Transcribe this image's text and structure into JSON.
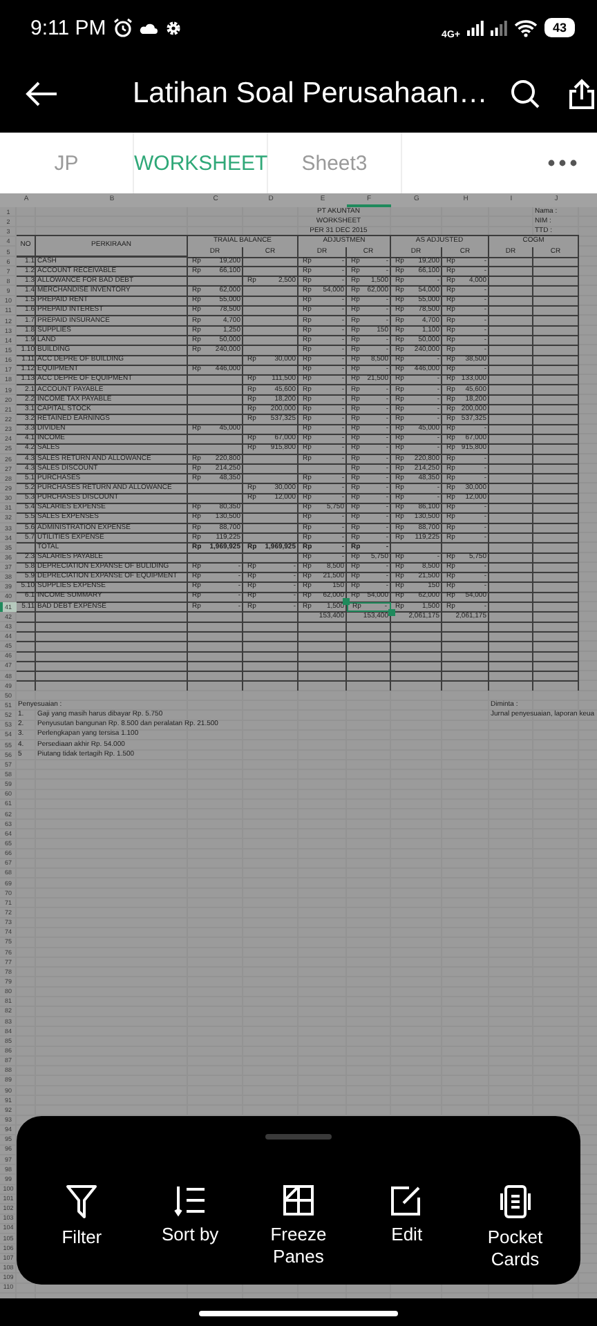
{
  "status_bar": {
    "time": "9:11 PM",
    "network": "4G+",
    "battery": "43"
  },
  "app_bar": {
    "title": "Latihan Soal Perusahaan…"
  },
  "sheet_tabs": [
    {
      "label": "JP",
      "selected": false
    },
    {
      "label": "WORKSHEET",
      "selected": true
    },
    {
      "label": "Sheet3",
      "selected": false
    }
  ],
  "spreadsheet": {
    "columns": [
      {
        "label": "A",
        "selected": false
      },
      {
        "label": "B",
        "selected": false
      },
      {
        "label": "C",
        "selected": false
      },
      {
        "label": "D",
        "selected": false
      },
      {
        "label": "E",
        "selected": false
      },
      {
        "label": "F",
        "selected": true
      },
      {
        "label": "G",
        "selected": false
      },
      {
        "label": "H",
        "selected": false
      },
      {
        "label": "I",
        "selected": false
      },
      {
        "label": "J",
        "selected": false
      }
    ],
    "rows": [
      {
        "kind": "title",
        "n": "1",
        "selected": false,
        "title": "PT AKUNTAN",
        "side": "Nama :"
      },
      {
        "kind": "title",
        "n": "2",
        "selected": false,
        "title": "WORKSHEET",
        "side": "NIM   :"
      },
      {
        "kind": "title",
        "n": "3",
        "selected": false,
        "title": "PER 31 DEC 2015",
        "side": "TTD   :"
      },
      {
        "kind": "header",
        "n": [
          "4",
          "5"
        ],
        "selected": false,
        "no": "NO",
        "account": "PERKIRAAN",
        "groups": [
          {
            "label": "TRAIAL BALANCE",
            "sub": [
              "DR",
              "CR"
            ]
          },
          {
            "label": "ADJUSTMEN",
            "sub": [
              "DR",
              "CR"
            ]
          },
          {
            "label": "AS ADJUSTED",
            "sub": [
              "DR",
              "CR"
            ]
          },
          {
            "label": "COGM",
            "sub": [
              "DR",
              "CR"
            ]
          }
        ]
      },
      {
        "kind": "account",
        "n": "6",
        "selected": false,
        "no": "1.1",
        "account": "CASH",
        "amounts": {
          "tb_dr": [
            "Rp",
            "19,200"
          ],
          "adj_dr": [
            "Rp",
            "-"
          ],
          "adj_cr": [
            "Rp",
            "-"
          ],
          "aa_dr": [
            "Rp",
            "19,200"
          ],
          "aa_cr": [
            "Rp",
            "-"
          ]
        }
      },
      {
        "kind": "account",
        "n": "7",
        "selected": false,
        "no": "1.2",
        "account": "ACCOUNT RECEIVABLE",
        "amounts": {
          "tb_dr": [
            "Rp",
            "66,100"
          ],
          "adj_dr": [
            "Rp",
            "-"
          ],
          "adj_cr": [
            "Rp",
            "-"
          ],
          "aa_dr": [
            "Rp",
            "66,100"
          ],
          "aa_cr": [
            "Rp",
            "-"
          ]
        }
      },
      {
        "kind": "account",
        "n": "8",
        "selected": false,
        "no": "1.3",
        "account": "ALLOWANCE FOR BAD DEBT",
        "amounts": {
          "tb_cr": [
            "Rp",
            "2,500"
          ],
          "adj_dr": [
            "Rp",
            "-"
          ],
          "adj_cr": [
            "Rp",
            "1,500"
          ],
          "aa_dr": [
            "Rp",
            "-"
          ],
          "aa_cr": [
            "Rp",
            "4,000"
          ]
        }
      },
      {
        "kind": "account",
        "n": "9",
        "selected": false,
        "no": "1.4",
        "account": "MERCHANDISE INVENTORY",
        "amounts": {
          "tb_dr": [
            "Rp",
            "62,000"
          ],
          "adj_dr": [
            "Rp",
            "54,000"
          ],
          "adj_cr": [
            "Rp",
            "62,000"
          ],
          "aa_dr": [
            "Rp",
            "54,000"
          ],
          "aa_cr": [
            "Rp",
            "-"
          ]
        }
      },
      {
        "kind": "account",
        "n": "10",
        "selected": false,
        "no": "1.5",
        "account": "PREPAID RENT",
        "amounts": {
          "tb_dr": [
            "Rp",
            "55,000"
          ],
          "adj_dr": [
            "Rp",
            "-"
          ],
          "adj_cr": [
            "Rp",
            "-"
          ],
          "aa_dr": [
            "Rp",
            "55,000"
          ],
          "aa_cr": [
            "Rp",
            "-"
          ]
        }
      },
      {
        "kind": "account",
        "n": "11",
        "selected": false,
        "no": "1.6",
        "account": "PREPAID INTEREST",
        "amounts": {
          "tb_dr": [
            "Rp",
            "78,500"
          ],
          "adj_dr": [
            "Rp",
            "-"
          ],
          "adj_cr": [
            "Rp",
            "-"
          ],
          "aa_dr": [
            "Rp",
            "78,500"
          ],
          "aa_cr": [
            "Rp",
            "-"
          ]
        }
      },
      {
        "kind": "account",
        "n": "12",
        "selected": false,
        "no": "1.7",
        "account": "PREPAID INSURANCE",
        "amounts": {
          "tb_dr": [
            "Rp",
            "4,700"
          ],
          "adj_dr": [
            "Rp",
            "-"
          ],
          "adj_cr": [
            "Rp",
            "-"
          ],
          "aa_dr": [
            "Rp",
            "4,700"
          ],
          "aa_cr": [
            "Rp",
            "-"
          ]
        }
      },
      {
        "kind": "account",
        "n": "13",
        "selected": false,
        "no": "1.8",
        "account": "SUPPLIES",
        "amounts": {
          "tb_dr": [
            "Rp",
            "1,250"
          ],
          "adj_dr": [
            "Rp",
            "-"
          ],
          "adj_cr": [
            "Rp",
            "150"
          ],
          "aa_dr": [
            "Rp",
            "1,100"
          ],
          "aa_cr": [
            "Rp",
            "-"
          ]
        }
      },
      {
        "kind": "account",
        "n": "14",
        "selected": false,
        "no": "1.9",
        "account": "LAND",
        "amounts": {
          "tb_dr": [
            "Rp",
            "50,000"
          ],
          "adj_dr": [
            "Rp",
            "-"
          ],
          "adj_cr": [
            "Rp",
            "-"
          ],
          "aa_dr": [
            "Rp",
            "50,000"
          ],
          "aa_cr": [
            "Rp",
            "-"
          ]
        }
      },
      {
        "kind": "account",
        "n": "15",
        "selected": false,
        "no": "1.10",
        "account": "BUILDING",
        "amounts": {
          "tb_dr": [
            "Rp",
            "240,000"
          ],
          "adj_dr": [
            "Rp",
            "-"
          ],
          "adj_cr": [
            "Rp",
            "-"
          ],
          "aa_dr": [
            "Rp",
            "240,000"
          ],
          "aa_cr": [
            "Rp",
            "-"
          ]
        }
      },
      {
        "kind": "account",
        "n": "16",
        "selected": false,
        "no": "1.11",
        "account": "ACC DEPRE OF  BUILDING",
        "amounts": {
          "tb_cr": [
            "Rp",
            "30,000"
          ],
          "adj_dr": [
            "Rp",
            "-"
          ],
          "adj_cr": [
            "Rp",
            "8,500"
          ],
          "aa_dr": [
            "Rp",
            "-"
          ],
          "aa_cr": [
            "Rp",
            "38,500"
          ]
        }
      },
      {
        "kind": "account",
        "n": "17",
        "selected": false,
        "no": "1.12",
        "account": "EQUIPMENT",
        "amounts": {
          "tb_dr": [
            "Rp",
            "446,000"
          ],
          "adj_dr": [
            "Rp",
            "-"
          ],
          "adj_cr": [
            "Rp",
            "-"
          ],
          "aa_dr": [
            "Rp",
            "446,000"
          ],
          "aa_cr": [
            "Rp",
            "-"
          ]
        }
      },
      {
        "kind": "account",
        "n": "18",
        "selected": false,
        "no": "1.13",
        "account": "ACC DEPRE OF  EQUIPMENT",
        "amounts": {
          "tb_cr": [
            "Rp",
            "111,500"
          ],
          "adj_dr": [
            "Rp",
            "-"
          ],
          "adj_cr": [
            "Rp",
            "21,500"
          ],
          "aa_dr": [
            "Rp",
            "-"
          ],
          "aa_cr": [
            "Rp",
            "133,000"
          ]
        }
      },
      {
        "kind": "account",
        "n": "19",
        "selected": false,
        "no": "2.1",
        "account": "ACCOUNT PAYABLE",
        "amounts": {
          "tb_cr": [
            "Rp",
            "45,600"
          ],
          "adj_dr": [
            "Rp",
            "-"
          ],
          "adj_cr": [
            "Rp",
            "-"
          ],
          "aa_dr": [
            "Rp",
            "-"
          ],
          "aa_cr": [
            "Rp",
            "45,600"
          ]
        }
      },
      {
        "kind": "account",
        "n": "20",
        "selected": false,
        "no": "2.2",
        "account": "INCOME TAX PAYABLE",
        "amounts": {
          "tb_cr": [
            "Rp",
            "18,200"
          ],
          "adj_dr": [
            "Rp",
            "-"
          ],
          "adj_cr": [
            "Rp",
            "-"
          ],
          "aa_dr": [
            "Rp",
            "-"
          ],
          "aa_cr": [
            "Rp",
            "18,200"
          ]
        }
      },
      {
        "kind": "account",
        "n": "21",
        "selected": false,
        "no": "3.1",
        "account": "CAPITAL STOCK",
        "amounts": {
          "tb_cr": [
            "Rp",
            "200,000"
          ],
          "adj_dr": [
            "Rp",
            "-"
          ],
          "adj_cr": [
            "Rp",
            "-"
          ],
          "aa_dr": [
            "Rp",
            "-"
          ],
          "aa_cr": [
            "Rp",
            "200,000"
          ]
        }
      },
      {
        "kind": "account",
        "n": "22",
        "selected": false,
        "no": "3.2",
        "account": "RETAINED EARNINGS",
        "amounts": {
          "tb_cr": [
            "Rp",
            "537,325"
          ],
          "adj_dr": [
            "Rp",
            "-"
          ],
          "adj_cr": [
            "Rp",
            "-"
          ],
          "aa_dr": [
            "Rp",
            "-"
          ],
          "aa_cr": [
            "Rp",
            "537,325"
          ]
        }
      },
      {
        "kind": "account",
        "n": "23",
        "selected": false,
        "no": "3.3",
        "account": "DIVIDEN",
        "amounts": {
          "tb_dr": [
            "Rp",
            "45,000"
          ],
          "adj_dr": [
            "Rp",
            "-"
          ],
          "adj_cr": [
            "Rp",
            "-"
          ],
          "aa_dr": [
            "Rp",
            "45,000"
          ],
          "aa_cr": [
            "Rp",
            "-"
          ]
        }
      },
      {
        "kind": "account",
        "n": "24",
        "selected": false,
        "no": "4.1",
        "account": "INCOME",
        "amounts": {
          "tb_cr": [
            "Rp",
            "67,000"
          ],
          "adj_dr": [
            "Rp",
            "-"
          ],
          "adj_cr": [
            "Rp",
            "-"
          ],
          "aa_dr": [
            "Rp",
            "-"
          ],
          "aa_cr": [
            "Rp",
            "67,000"
          ]
        }
      },
      {
        "kind": "account",
        "n": "25",
        "selected": false,
        "no": "4.2",
        "account": "SALES",
        "amounts": {
          "tb_cr": [
            "Rp",
            "915,800"
          ],
          "adj_dr": [
            "Rp",
            "-"
          ],
          "adj_cr": [
            "Rp",
            "-"
          ],
          "aa_dr": [
            "Rp",
            "-"
          ],
          "aa_cr": [
            "Rp",
            "915,800"
          ]
        }
      },
      {
        "kind": "account",
        "n": "26",
        "selected": false,
        "no": "4.3",
        "account": "SALES  RETURN AND ALLOWANCE",
        "amounts": {
          "tb_dr": [
            "Rp",
            "220,800"
          ],
          "adj_dr": [
            "Rp",
            "-"
          ],
          "adj_cr": [
            "Rp",
            "-"
          ],
          "aa_dr": [
            "Rp",
            "220,800"
          ],
          "aa_cr": [
            "Rp",
            "-"
          ]
        }
      },
      {
        "kind": "account",
        "n": "27",
        "selected": false,
        "no": "4.3",
        "account": "SALES DISCOUNT",
        "amounts": {
          "tb_dr": [
            "Rp",
            "214,250"
          ],
          "adj_cr": [
            "Rp",
            "-"
          ],
          "aa_dr": [
            "Rp",
            "214,250"
          ],
          "aa_cr": [
            "Rp",
            "-"
          ]
        }
      },
      {
        "kind": "account",
        "n": "28",
        "selected": false,
        "no": "5.1",
        "account": "PURCHASES",
        "amounts": {
          "tb_dr": [
            "Rp",
            "48,350"
          ],
          "adj_dr": [
            "Rp",
            "-"
          ],
          "adj_cr": [
            "Rp",
            "-"
          ],
          "aa_dr": [
            "Rp",
            "48,350"
          ],
          "aa_cr": [
            "Rp",
            "-"
          ]
        }
      },
      {
        "kind": "account",
        "n": "29",
        "selected": false,
        "no": "5.2",
        "account": "PURCHASES RETURN AND ALLOWANCE",
        "amounts": {
          "tb_cr": [
            "Rp",
            "30,000"
          ],
          "adj_dr": [
            "Rp",
            "-"
          ],
          "adj_cr": [
            "Rp",
            "-"
          ],
          "aa_dr": [
            "Rp",
            "-"
          ],
          "aa_cr": [
            "Rp",
            "30,000"
          ]
        }
      },
      {
        "kind": "account",
        "n": "30",
        "selected": false,
        "no": "5.3",
        "account": "PURCHASES DISCOUNT",
        "amounts": {
          "tb_cr": [
            "Rp",
            "12,000"
          ],
          "adj_dr": [
            "Rp",
            "-"
          ],
          "adj_cr": [
            "Rp",
            "-"
          ],
          "aa_dr": [
            "Rp",
            "-"
          ],
          "aa_cr": [
            "Rp",
            "12,000"
          ]
        }
      },
      {
        "kind": "account",
        "n": "31",
        "selected": false,
        "no": "5.4",
        "account": "SALARIES EXPENSE",
        "amounts": {
          "tb_dr": [
            "Rp",
            "80,350"
          ],
          "adj_dr": [
            "Rp",
            "5,750"
          ],
          "adj_cr": [
            "Rp",
            "-"
          ],
          "aa_dr": [
            "Rp",
            "86,100"
          ],
          "aa_cr": [
            "Rp",
            "-"
          ]
        }
      },
      {
        "kind": "account",
        "n": "32",
        "selected": false,
        "no": "5.5",
        "account": "SALES EXPENSES",
        "amounts": {
          "tb_dr": [
            "Rp",
            "130,500"
          ],
          "adj_dr": [
            "Rp",
            "-"
          ],
          "adj_cr": [
            "Rp",
            "-"
          ],
          "aa_dr": [
            "Rp",
            "130,500"
          ],
          "aa_cr": [
            "Rp",
            "-"
          ]
        }
      },
      {
        "kind": "account",
        "n": "33",
        "selected": false,
        "no": "5.6",
        "account": "ADMINISTRATION EXPENSE",
        "amounts": {
          "tb_dr": [
            "Rp",
            "88,700"
          ],
          "adj_dr": [
            "Rp",
            "-"
          ],
          "adj_cr": [
            "Rp",
            "-"
          ],
          "aa_dr": [
            "Rp",
            "88,700"
          ],
          "aa_cr": [
            "Rp",
            "-"
          ]
        }
      },
      {
        "kind": "account",
        "n": "34",
        "selected": false,
        "no": "5.7",
        "account": "UTILITIES EXPENSE",
        "amounts": {
          "tb_dr": [
            "Rp",
            "119,225"
          ],
          "adj_dr": [
            "Rp",
            "-"
          ],
          "adj_cr": [
            "Rp",
            "-"
          ],
          "aa_dr": [
            "Rp",
            "119,225"
          ],
          "aa_cr": [
            "Rp",
            "-"
          ]
        }
      },
      {
        "kind": "total",
        "n": "35",
        "selected": false,
        "account": "TOTAL",
        "amounts": {
          "tb_dr": [
            "Rp",
            "1,969,925"
          ],
          "tb_cr": [
            "Rp",
            "1,969,925"
          ],
          "adj_dr": [
            "Rp",
            "-"
          ],
          "adj_cr": [
            "Rp",
            "-"
          ]
        }
      },
      {
        "kind": "account",
        "n": "36",
        "selected": false,
        "no": "2.3",
        "account": "SALARIES PAYABLE",
        "amounts": {
          "adj_dr": [
            "Rp",
            "-"
          ],
          "adj_cr": [
            "Rp",
            "5,750"
          ],
          "aa_dr": [
            "Rp",
            "-"
          ],
          "aa_cr": [
            "Rp",
            "5,750"
          ]
        }
      },
      {
        "kind": "account",
        "n": "37",
        "selected": false,
        "no": "5.8",
        "account": "DEPRECIATION EXPANSE OF BULIDING",
        "amounts": {
          "tb_dr": [
            "Rp",
            "-"
          ],
          "tb_cr": [
            "Rp",
            "-"
          ],
          "adj_dr": [
            "Rp",
            "8,500"
          ],
          "adj_cr": [
            "Rp",
            "-"
          ],
          "aa_dr": [
            "Rp",
            "8,500"
          ],
          "aa_cr": [
            "Rp",
            "-"
          ]
        }
      },
      {
        "kind": "account",
        "n": "38",
        "selected": false,
        "no": "5.9",
        "account": "DEPRECIATION EXPANSE OF EQUIPMENT",
        "amounts": {
          "tb_dr": [
            "Rp",
            "-"
          ],
          "tb_cr": [
            "Rp",
            "-"
          ],
          "adj_dr": [
            "Rp",
            "21,500"
          ],
          "adj_cr": [
            "Rp",
            "-"
          ],
          "aa_dr": [
            "Rp",
            "21,500"
          ],
          "aa_cr": [
            "Rp",
            "-"
          ]
        }
      },
      {
        "kind": "account",
        "n": "39",
        "selected": false,
        "no": "5.10",
        "account": "SUPPLIES EXPENSE",
        "amounts": {
          "tb_dr": [
            "Rp",
            "-"
          ],
          "tb_cr": [
            "Rp",
            "-"
          ],
          "adj_dr": [
            "Rp",
            "150"
          ],
          "adj_cr": [
            "Rp",
            "-"
          ],
          "aa_dr": [
            "Rp",
            "150"
          ],
          "aa_cr": [
            "Rp",
            "-"
          ]
        }
      },
      {
        "kind": "account",
        "n": "40",
        "selected": false,
        "no": "6.1",
        "account": "INCOME SUMMARY",
        "amounts": {
          "tb_dr": [
            "Rp",
            "-"
          ],
          "tb_cr": [
            "Rp",
            "-"
          ],
          "adj_dr": [
            "Rp",
            "62,000"
          ],
          "adj_cr": [
            "Rp",
            "54,000"
          ],
          "aa_dr": [
            "Rp",
            "62,000"
          ],
          "aa_cr": [
            "Rp",
            "54,000"
          ]
        }
      },
      {
        "kind": "account",
        "n": "41",
        "selected": true,
        "no": "5.11",
        "account": "BAD DEBT EXPENSE",
        "amounts": {
          "tb_dr": [
            "Rp",
            "-"
          ],
          "tb_cr": [
            "Rp",
            "-"
          ],
          "adj_dr": [
            "Rp",
            "1,500"
          ],
          "adj_cr": [
            "Rp",
            "-"
          ],
          "aa_dr": [
            "Rp",
            "1,500"
          ],
          "aa_cr": [
            "Rp",
            "-"
          ]
        }
      },
      {
        "kind": "sum",
        "n": "42",
        "selected": false,
        "amounts": {
          "adj_dr": "153,400",
          "adj_cr": "153,400",
          "aa_dr": "2,061,175",
          "aa_cr": "2,061,175"
        }
      },
      {
        "kind": "blank_box",
        "n": "43",
        "selected": false
      },
      {
        "kind": "blank_box",
        "n": "44",
        "selected": false
      },
      {
        "kind": "blank_box",
        "n": "45",
        "selected": false
      },
      {
        "kind": "blank_box",
        "n": "46",
        "selected": false
      },
      {
        "kind": "blank_box",
        "n": "47",
        "selected": false
      },
      {
        "kind": "blank_box",
        "n": "48",
        "selected": false
      },
      {
        "kind": "blank_box",
        "n": "49",
        "selected": false
      },
      {
        "kind": "blank",
        "n": "50",
        "selected": false
      },
      {
        "kind": "note_title",
        "n": "51",
        "selected": false,
        "text": "Penyesuaian :",
        "side": "Diminta :"
      },
      {
        "kind": "note",
        "n": "52",
        "selected": false,
        "marker": "1.",
        "text": "Gaji yang masih harus dibayar  Rp. 5.750",
        "side": "Jurnal penyesuaian, laporan keua"
      },
      {
        "kind": "note",
        "n": "53",
        "selected": false,
        "marker": "2.",
        "text": "Penyusutan bangunan  Rp. 8.500 dan peralatan  Rp. 21.500"
      },
      {
        "kind": "note",
        "n": "54",
        "selected": false,
        "marker": "3.",
        "text": "Perlengkapan yang tersisa  1.100"
      },
      {
        "kind": "note",
        "n": "55",
        "selected": false,
        "marker": "4.",
        "text": "Persediaan akhir Rp. 54.000"
      },
      {
        "kind": "note",
        "n": "56",
        "selected": false,
        "marker": "5",
        "text": "Piutang tidak tertagih Rp. 1.500"
      },
      {
        "kind": "blank",
        "n": "57",
        "selected": false
      },
      {
        "kind": "blank",
        "n": "58",
        "selected": false
      },
      {
        "kind": "blank",
        "n": "59",
        "selected": false
      },
      {
        "kind": "blank",
        "n": "60",
        "selected": false
      },
      {
        "kind": "blank",
        "n": "61",
        "selected": false
      },
      {
        "kind": "blank",
        "n": "62",
        "selected": false
      },
      {
        "kind": "blank",
        "n": "63",
        "selected": false
      },
      {
        "kind": "blank",
        "n": "64",
        "selected": false
      },
      {
        "kind": "blank",
        "n": "65",
        "selected": false
      },
      {
        "kind": "blank",
        "n": "66",
        "selected": false
      },
      {
        "kind": "blank",
        "n": "67",
        "selected": false
      },
      {
        "kind": "blank",
        "n": "68",
        "selected": false
      },
      {
        "kind": "blank",
        "n": "69",
        "selected": false
      },
      {
        "kind": "blank",
        "n": "70",
        "selected": false
      },
      {
        "kind": "blank",
        "n": "71",
        "selected": false
      },
      {
        "kind": "blank",
        "n": "72",
        "selected": false
      },
      {
        "kind": "blank",
        "n": "73",
        "selected": false
      },
      {
        "kind": "blank",
        "n": "74",
        "selected": false
      },
      {
        "kind": "blank",
        "n": "75",
        "selected": false
      },
      {
        "kind": "blank",
        "n": "76",
        "selected": false
      },
      {
        "kind": "blank",
        "n": "77",
        "selected": false
      },
      {
        "kind": "blank",
        "n": "78",
        "selected": false
      },
      {
        "kind": "blank",
        "n": "79",
        "selected": false
      },
      {
        "kind": "blank",
        "n": "80",
        "selected": false
      },
      {
        "kind": "blank",
        "n": "81",
        "selected": false
      },
      {
        "kind": "blank",
        "n": "82",
        "selected": false
      },
      {
        "kind": "blank",
        "n": "83",
        "selected": false
      },
      {
        "kind": "blank",
        "n": "84",
        "selected": false
      },
      {
        "kind": "blank",
        "n": "85",
        "selected": false
      },
      {
        "kind": "blank",
        "n": "86",
        "selected": false
      },
      {
        "kind": "blank",
        "n": "87",
        "selected": false
      },
      {
        "kind": "blank",
        "n": "88",
        "selected": false
      },
      {
        "kind": "blank",
        "n": "89",
        "selected": false
      },
      {
        "kind": "blank",
        "n": "90",
        "selected": false
      },
      {
        "kind": "blank",
        "n": "91",
        "selected": false
      },
      {
        "kind": "blank",
        "n": "92",
        "selected": false
      },
      {
        "kind": "blank",
        "n": "93",
        "selected": false
      },
      {
        "kind": "blank",
        "n": "94",
        "selected": false
      },
      {
        "kind": "blank",
        "n": "95",
        "selected": false
      },
      {
        "kind": "blank",
        "n": "96",
        "selected": false
      },
      {
        "kind": "blank",
        "n": "97",
        "selected": false
      },
      {
        "kind": "blank",
        "n": "98",
        "selected": false
      },
      {
        "kind": "blank",
        "n": "99",
        "selected": false
      },
      {
        "kind": "blank",
        "n": "100",
        "selected": false
      },
      {
        "kind": "blank",
        "n": "101",
        "selected": false
      },
      {
        "kind": "blank",
        "n": "102",
        "selected": false
      },
      {
        "kind": "blank",
        "n": "103",
        "selected": false
      },
      {
        "kind": "blank",
        "n": "104",
        "selected": false
      },
      {
        "kind": "blank",
        "n": "105",
        "selected": false
      },
      {
        "kind": "blank",
        "n": "106",
        "selected": false
      },
      {
        "kind": "blank",
        "n": "107",
        "selected": false
      },
      {
        "kind": "blank",
        "n": "108",
        "selected": false
      },
      {
        "kind": "blank",
        "n": "109",
        "selected": false
      },
      {
        "kind": "blank",
        "n": "110",
        "selected": false
      }
    ]
  },
  "action_sheet": {
    "actions": [
      {
        "label": "Filter"
      },
      {
        "label": "Sort by"
      },
      {
        "label": "Freeze Panes"
      },
      {
        "label": "Edit"
      },
      {
        "label": "Pocket Cards"
      }
    ]
  }
}
